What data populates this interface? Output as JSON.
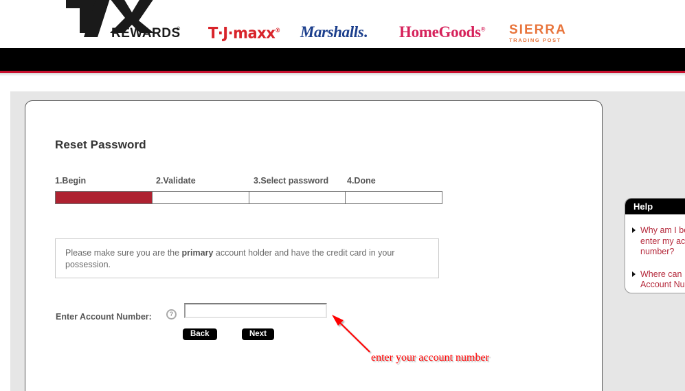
{
  "header": {
    "primary_logo": {
      "main": "TJX",
      "sub": "REWARDS",
      "registered": "®"
    },
    "brands": [
      {
        "name": "T·J·maxx",
        "registered": "®",
        "color": "#D8232A"
      },
      {
        "name": "Marshalls",
        "punctuation": ".",
        "color": "#1B3E8C"
      },
      {
        "name": "HomeGoods",
        "registered": "®",
        "color": "#D6225B"
      },
      {
        "name": "SIERRA",
        "registered": "®",
        "tagline": "TRADING POST",
        "color": "#E8743B"
      }
    ],
    "nav_bar_color": "#000000",
    "nav_accent_color": "#C8102E"
  },
  "main": {
    "page_title": "Reset Password",
    "steps": [
      {
        "label": "1.Begin",
        "active": true
      },
      {
        "label": "2.Validate",
        "active": false
      },
      {
        "label": "3.Select password",
        "active": false
      },
      {
        "label": "4.Done",
        "active": false
      }
    ],
    "progress_fill_color": "#AE2231",
    "notice": {
      "before": "Please make sure you are the ",
      "emphasis": "primary",
      "after": " account holder and have the credit card in your possession."
    },
    "form": {
      "account_label": "Enter Account Number:",
      "help_icon_glyph": "?",
      "account_value": "",
      "account_placeholder": ""
    },
    "buttons": {
      "back_label": "Back",
      "next_label": "Next"
    }
  },
  "annotation": {
    "text": "enter your account number",
    "color": "#FF0000"
  },
  "help_panel": {
    "title": "Help",
    "link_color": "#B52A3C",
    "links": [
      "Why am I being asked to enter my account number?",
      "Where can I find my Account Number?"
    ]
  }
}
